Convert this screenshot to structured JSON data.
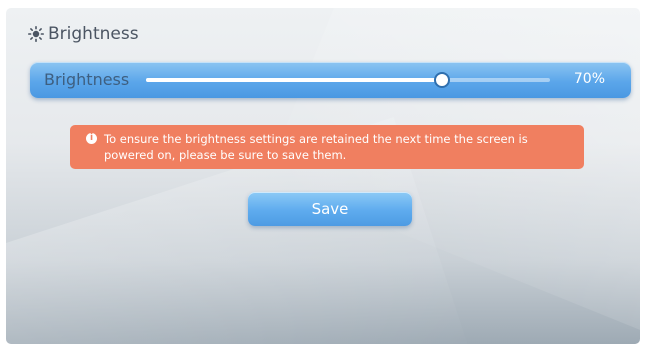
{
  "header": {
    "title": "Brightness",
    "icon": "sun-icon"
  },
  "brightness_slider": {
    "label": "Brightness",
    "value_text": "70%",
    "fill_fraction": 0.73
  },
  "notice": {
    "icon": "info-icon",
    "icon_glyph": "i",
    "text": "To ensure the brightness settings are retained the next time the screen is powered on, please be sure to save them."
  },
  "actions": {
    "save_label": "Save"
  },
  "colors": {
    "accent_blue": "#5ba6ea",
    "warning_orange": "#f07f60"
  }
}
